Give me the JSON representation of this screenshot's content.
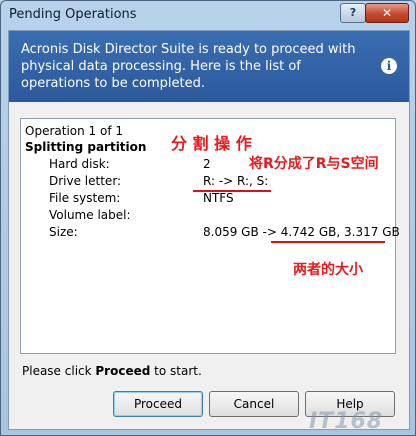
{
  "window": {
    "title": "Pending Operations"
  },
  "titlebar_buttons": {
    "help": "?",
    "close": "✕"
  },
  "header": {
    "text": "Acronis Disk Director Suite is ready to proceed with physical data processing. Here is the list of operations to be completed.",
    "icon": "info-icon"
  },
  "operation": {
    "counter": "Operation 1 of 1",
    "name": "Splitting partition",
    "rows": [
      {
        "label": "Hard disk:",
        "value": "2"
      },
      {
        "label": "Drive letter:",
        "value": "R: -> R:, S:"
      },
      {
        "label": "File system:",
        "value": "NTFS"
      },
      {
        "label": "Volume label:",
        "value": ""
      },
      {
        "label": "Size:",
        "value": "8.059 GB -> 4.742 GB, 3.317 GB"
      }
    ]
  },
  "annotations": {
    "split_op": "分 割 操 作",
    "split_r": "将R分成了R与S空间",
    "both_sizes": "两者的大小"
  },
  "footer": {
    "prefix": "Please click ",
    "bold": "Proceed",
    "suffix": " to start."
  },
  "buttons": {
    "proceed": "Proceed",
    "cancel": "Cancel",
    "help": "Help"
  },
  "watermark": "IT168"
}
